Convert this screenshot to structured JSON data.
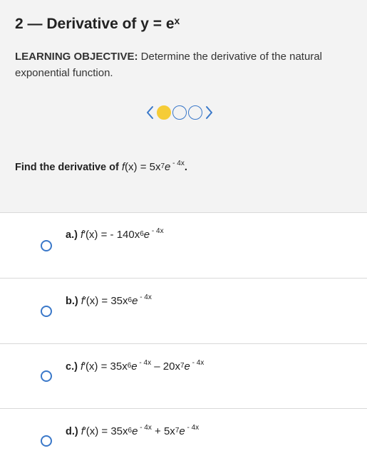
{
  "header": {
    "title": "2 — Derivative of y = e",
    "title_sup": "x",
    "objective_label": "LEARNING OBJECTIVE:",
    "objective_text": " Determine the derivative of the natural exponential function."
  },
  "nav": {
    "prev_icon": "chevron-left-icon",
    "next_icon": "chevron-right-icon",
    "step_dots": [
      {
        "state": "current",
        "color": "#f5cc37"
      },
      {
        "state": "pending",
        "color": "#3a78c9"
      },
      {
        "state": "pending",
        "color": "#3a78c9"
      }
    ]
  },
  "question": {
    "prompt": "Find the derivative of ",
    "fn": "f",
    "var": "(x)",
    "eq": " = 5x",
    "p1": "7",
    "e": "e",
    "exp": " - 4x",
    "end": "."
  },
  "options": [
    {
      "letter": "a.)",
      "fp": "f",
      "prime": "′",
      "var": "(x)",
      "eq": " = - 140x",
      "p1": "6",
      "e1": "e",
      "x1": " - 4x",
      "rest": "",
      "p2": "",
      "e2": "",
      "x2": ""
    },
    {
      "letter": "b.)",
      "fp": "f",
      "prime": "′",
      "var": "(x)",
      "eq": " = 35x",
      "p1": "6",
      "e1": "e",
      "x1": " - 4x",
      "rest": "",
      "p2": "",
      "e2": "",
      "x2": ""
    },
    {
      "letter": "c.)",
      "fp": "f",
      "prime": "′",
      "var": "(x)",
      "eq": " = 35x",
      "p1": "6",
      "e1": "e",
      "x1": " - 4x",
      "rest": " – 20x",
      "p2": "7",
      "e2": "e",
      "x2": " - 4x"
    },
    {
      "letter": "d.)",
      "fp": "f",
      "prime": "′",
      "var": "(x)",
      "eq": " = 35x",
      "p1": "6",
      "e1": "e",
      "x1": " - 4x",
      "rest": " + 5x",
      "p2": "7",
      "e2": "e",
      "x2": " - 4x"
    }
  ],
  "colors": {
    "accent": "#3a78c9",
    "current_dot": "#f5cc37",
    "header_bg": "#f3f3f3"
  }
}
